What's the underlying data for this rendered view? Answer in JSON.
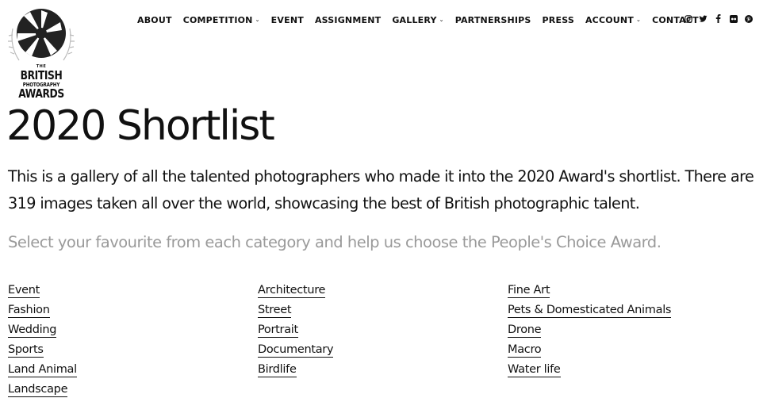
{
  "logo": {
    "the": "THE",
    "line1": "BRITISH",
    "line2": "PHOTOGRAPHY",
    "line3": "AWARDS"
  },
  "nav": {
    "items": [
      {
        "label": "ABOUT"
      },
      {
        "label": "COMPETITION"
      },
      {
        "label": "EVENT"
      },
      {
        "label": "ASSIGNMENT"
      },
      {
        "label": "GALLERY"
      },
      {
        "label": "PARTNERSHIPS"
      },
      {
        "label": "PRESS"
      },
      {
        "label": "ACCOUNT"
      },
      {
        "label": "CONTACT"
      }
    ]
  },
  "social": [
    "instagram-icon",
    "twitter-icon",
    "facebook-icon",
    "flickr-icon",
    "pinterest-icon"
  ],
  "page": {
    "title": "2020 Shortlist",
    "intro": "This is a gallery of all the talented photographers who made it into the 2020 Award's shortlist. There are 319 images taken all over the world, showcasing the best of British photographic talent.",
    "cta": "Select your favourite from each category and help us choose the People's Choice Award."
  },
  "categories": {
    "col1": [
      "Event",
      "Fashion",
      "Wedding",
      "Sports",
      "Land Animal",
      "Landscape"
    ],
    "col2": [
      "Architecture",
      "Street",
      "Portrait",
      "Documentary",
      "Birdlife"
    ],
    "col3": [
      "Fine Art",
      "Pets & Domesticated Animals",
      "Drone",
      "Macro",
      "Water life"
    ]
  }
}
